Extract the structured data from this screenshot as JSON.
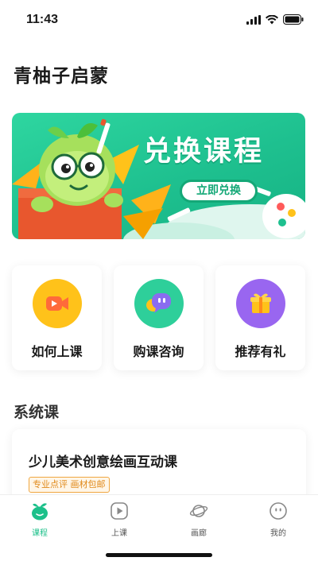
{
  "status_bar": {
    "time": "11:43",
    "icons": [
      "signal-icon",
      "wifi-icon",
      "battery-icon"
    ]
  },
  "header": {
    "title": "青柚子启蒙"
  },
  "banner": {
    "title": "兑换课程",
    "button_label": "立即兑换",
    "accent": "#1ec08f"
  },
  "features": [
    {
      "label": "如何上课",
      "icon": "video-camera-icon",
      "color": "#ffc21a"
    },
    {
      "label": "购课咨询",
      "icon": "chat-bubble-icon",
      "color": "#2ecf9a"
    },
    {
      "label": "推荐有礼",
      "icon": "gift-icon",
      "color": "#9966f0"
    }
  ],
  "section": {
    "title": "系统课"
  },
  "course": {
    "title": "少儿美术创意绘画互动课",
    "tag": "专业点评 画材包邮"
  },
  "tab_bar": {
    "active_color": "#1cc08a",
    "items": [
      {
        "label": "课程",
        "icon": "pomelo-icon",
        "active": true
      },
      {
        "label": "上课",
        "icon": "play-icon",
        "active": false
      },
      {
        "label": "画廊",
        "icon": "planet-icon",
        "active": false
      },
      {
        "label": "我的",
        "icon": "profile-face-icon",
        "active": false
      }
    ]
  }
}
